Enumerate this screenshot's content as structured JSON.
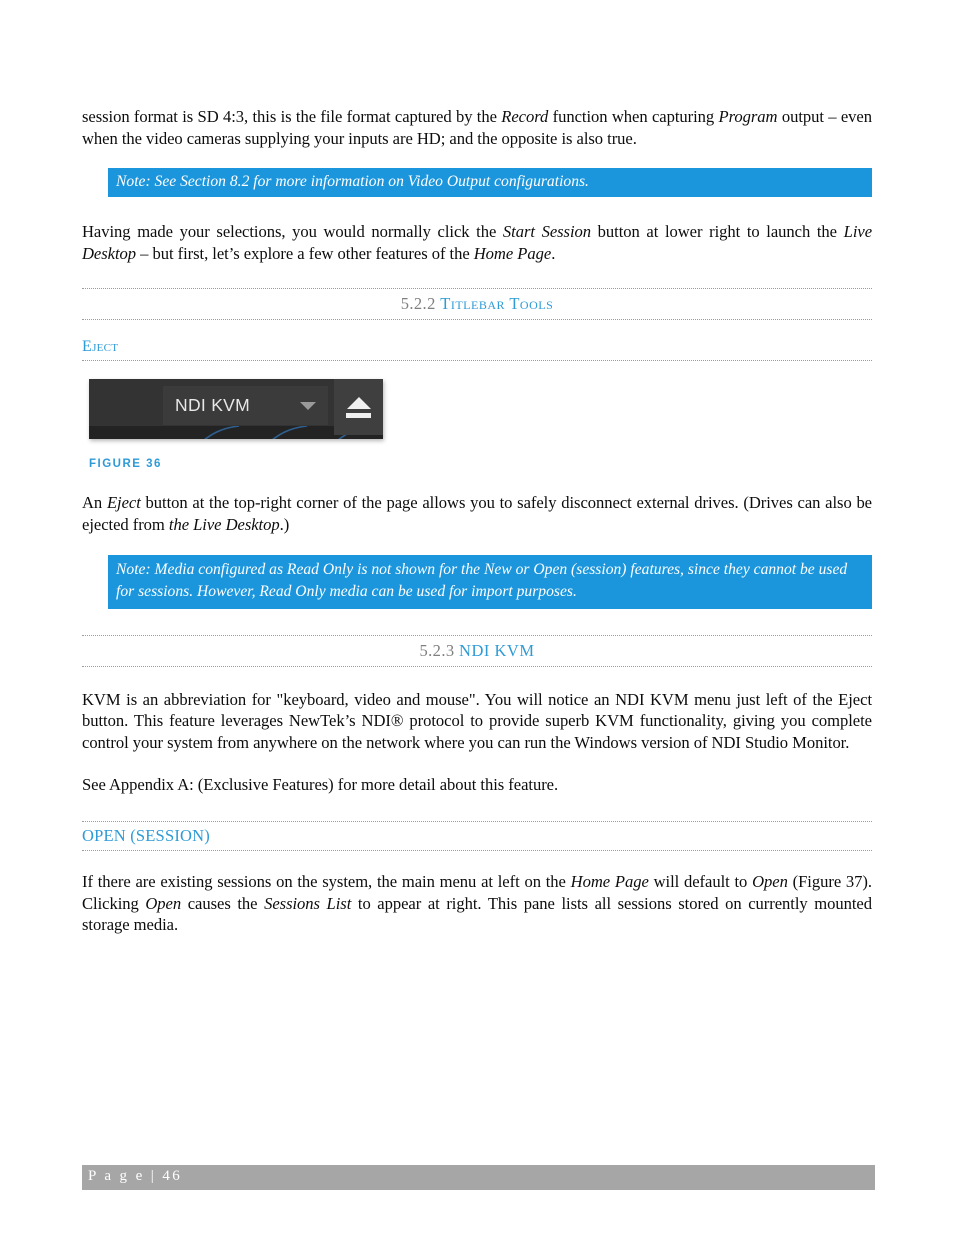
{
  "document": {
    "page_number": "46",
    "footer_label": "P a g e  | 46"
  },
  "colors": {
    "accent_blue": "#2e9bd6",
    "note_bg": "#1b96dc",
    "section_number_gray": "#7f7f7f",
    "footer_gray": "#a6a6a6",
    "figure_bg": "#333333"
  },
  "paragraphs": {
    "intro_p1_a": "session format is SD 4:3, this is the file format captured by the ",
    "intro_p1_rec": "Record",
    "intro_p1_b": " function when capturing ",
    "intro_p1_prog": "Program",
    "intro_p1_c": " output – even when the video cameras supplying your inputs are HD; and the opposite is also true.",
    "after_note_a": "Having made your selections, you would normally click the ",
    "after_note_start": "Start Session",
    "after_note_b": " button at lower right to launch the ",
    "after_note_live": "Live Desktop",
    "after_note_c": " – but first, let’s explore a few other features of the ",
    "after_note_home": "Home Page",
    "after_note_d": ".",
    "eject_a": "An ",
    "eject_it": "Eject",
    "eject_b": " button at the top-right corner of the page allows you to safely disconnect external drives.  (Drives can also be ejected from ",
    "eject_live": "the Live Desktop",
    "eject_c": ".)",
    "kvm_p": "KVM is an abbreviation for \"keyboard, video and mouse\".  You will notice an NDI KVM menu just left of the Eject button.  This feature leverages NewTek’s NDI® protocol to provide superb KVM functionality, giving you complete control your system from anywhere on the network where you can run the Windows version of NDI Studio Monitor.",
    "appendix_p": "See Appendix A: (Exclusive Features) for more detail about this feature.",
    "open_a": "If there are existing sessions on the system, the main menu at left on the ",
    "open_home": "Home Page",
    "open_b": " will default to ",
    "open_open1": "Open",
    "open_c": " (Figure 37). Clicking ",
    "open_open2": "Open",
    "open_d": " causes the ",
    "open_sess": "Sessions List",
    "open_e": " to appear at right.  This pane lists all sessions stored on currently mounted storage media."
  },
  "notes": {
    "note_1": "Note: See Section 8.2 for more information on Video Output configurations.",
    "note_2": "Note: Media configured as Read Only is not shown for the New or Open (session) features, since they cannot be used for sessions.  However, Read Only media can be used for import purposes."
  },
  "headings": {
    "section_522_number": "5.2.2 ",
    "section_522_title": "Titlebar Tools",
    "subhead_eject": "Eject",
    "section_523_number": "5.2.3 ",
    "section_523_title": "NDI KVM",
    "subhead_open_session": "OPEN (SESSION)"
  },
  "figure": {
    "caption": "FIGURE 36",
    "kvm_dropdown_label": "NDI KVM",
    "dropdown_icon": "chevron-down-icon",
    "eject_icon": "eject-icon"
  }
}
